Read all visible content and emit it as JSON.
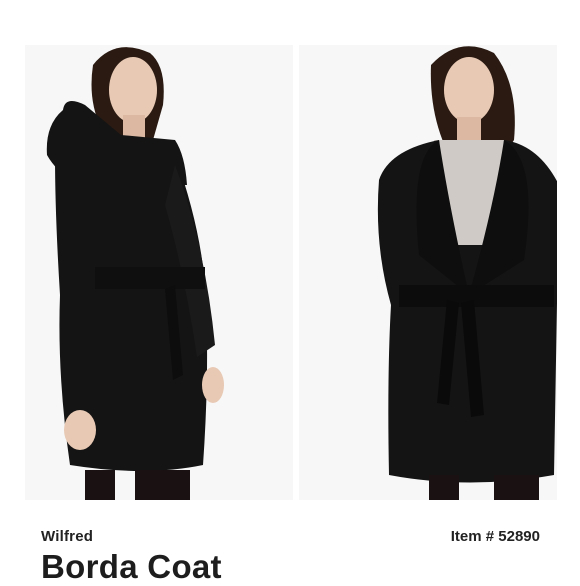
{
  "product": {
    "brand": "Wilfred",
    "item_number": "Item # 52890",
    "name": "Borda Coat"
  },
  "photos": [
    {
      "subject": "model-side-view",
      "coat_color": "#141414"
    },
    {
      "subject": "model-front-view",
      "coat_color": "#141414"
    }
  ],
  "colors": {
    "background": "#ffffff",
    "panel": "#f7f7f7",
    "coat": "#141414",
    "skin": "#e8c9b4",
    "hair": "#2a1a12",
    "sweater": "#cfcac6",
    "text": "#222222"
  }
}
